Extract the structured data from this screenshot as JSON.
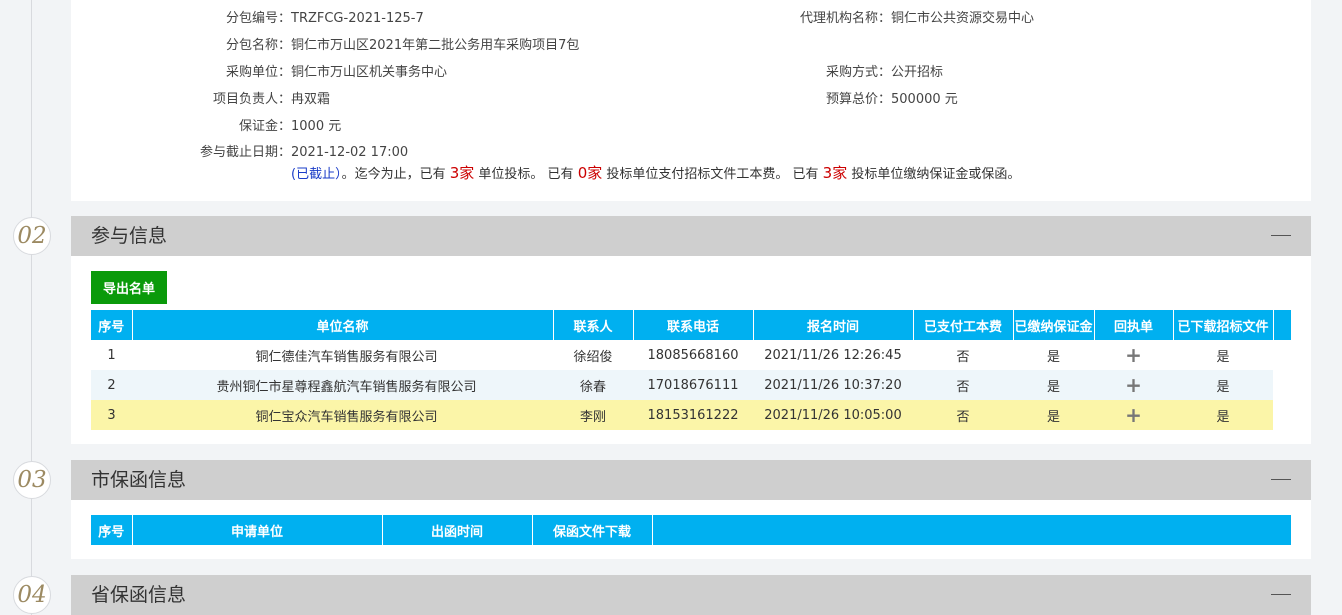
{
  "project_info": {
    "package_no_label": "分包编号：",
    "package_no": "TRZFCG-2021-125-7",
    "agency_label": "代理机构名称：",
    "agency": "铜仁市公共资源交易中心",
    "package_name_label": "分包名称：",
    "package_name": "铜仁市万山区2021年第二批公务用车采购项目7包",
    "buyer_label": "采购单位：",
    "buyer": "铜仁市万山区机关事务中心",
    "method_label": "采购方式：",
    "method": "公开招标",
    "owner_label": "项目负责人：",
    "owner": "冉双霜",
    "budget_label": "预算总价：",
    "budget": "500000 元",
    "deposit_label": "保证金：",
    "deposit": "1000 元",
    "deadline_label": "参与截止日期：",
    "deadline": "2021-12-02 17:00",
    "status_closed": "(已截止）",
    "status_text_1": "。迄今为止，已有",
    "bid_count": "3家",
    "status_text_2": "单位投标。 已有",
    "paid_count": "0家",
    "status_text_3": "投标单位支付招标文件工本费。 已有",
    "deposit_count": "3家",
    "status_text_4": "投标单位缴纳保证金或保函。"
  },
  "sections": {
    "s02_num": "02",
    "s02_title": "参与信息",
    "s03_num": "03",
    "s03_title": "市保函信息",
    "s04_num": "04",
    "s04_title": "省保函信息"
  },
  "participants": {
    "export_label": "导出名单",
    "headers": [
      "序号",
      "单位名称",
      "联系人",
      "联系电话",
      "报名时间",
      "已支付工本费",
      "已缴纳保证金",
      "回执单",
      "已下载招标文件"
    ],
    "rows": [
      {
        "idx": "1",
        "name": "铜仁德佳汽车销售服务有限公司",
        "contact": "徐绍俊",
        "phone": "18085668160",
        "time": "2021/11/26 12:26:45",
        "paid": "否",
        "deposit": "是",
        "receipt": "+",
        "downloaded": "是"
      },
      {
        "idx": "2",
        "name": "贵州铜仁市星尊程鑫航汽车销售服务有限公司",
        "contact": "徐春",
        "phone": "17018676111",
        "time": "2021/11/26 10:37:20",
        "paid": "否",
        "deposit": "是",
        "receipt": "+",
        "downloaded": "是"
      },
      {
        "idx": "3",
        "name": "铜仁宝众汽车销售服务有限公司",
        "contact": "李刚",
        "phone": "18153161222",
        "time": "2021/11/26 10:05:00",
        "paid": "否",
        "deposit": "是",
        "receipt": "+",
        "downloaded": "是"
      }
    ]
  },
  "city_guarantee": {
    "headers": [
      "序号",
      "申请单位",
      "出函时间",
      "保函文件下载"
    ]
  },
  "colors": {
    "header_blue": "#00b0f0",
    "export_green": "#0a9a0a",
    "highlight_yellow": "#fbf5a8",
    "negative_red": "#cc0000"
  }
}
